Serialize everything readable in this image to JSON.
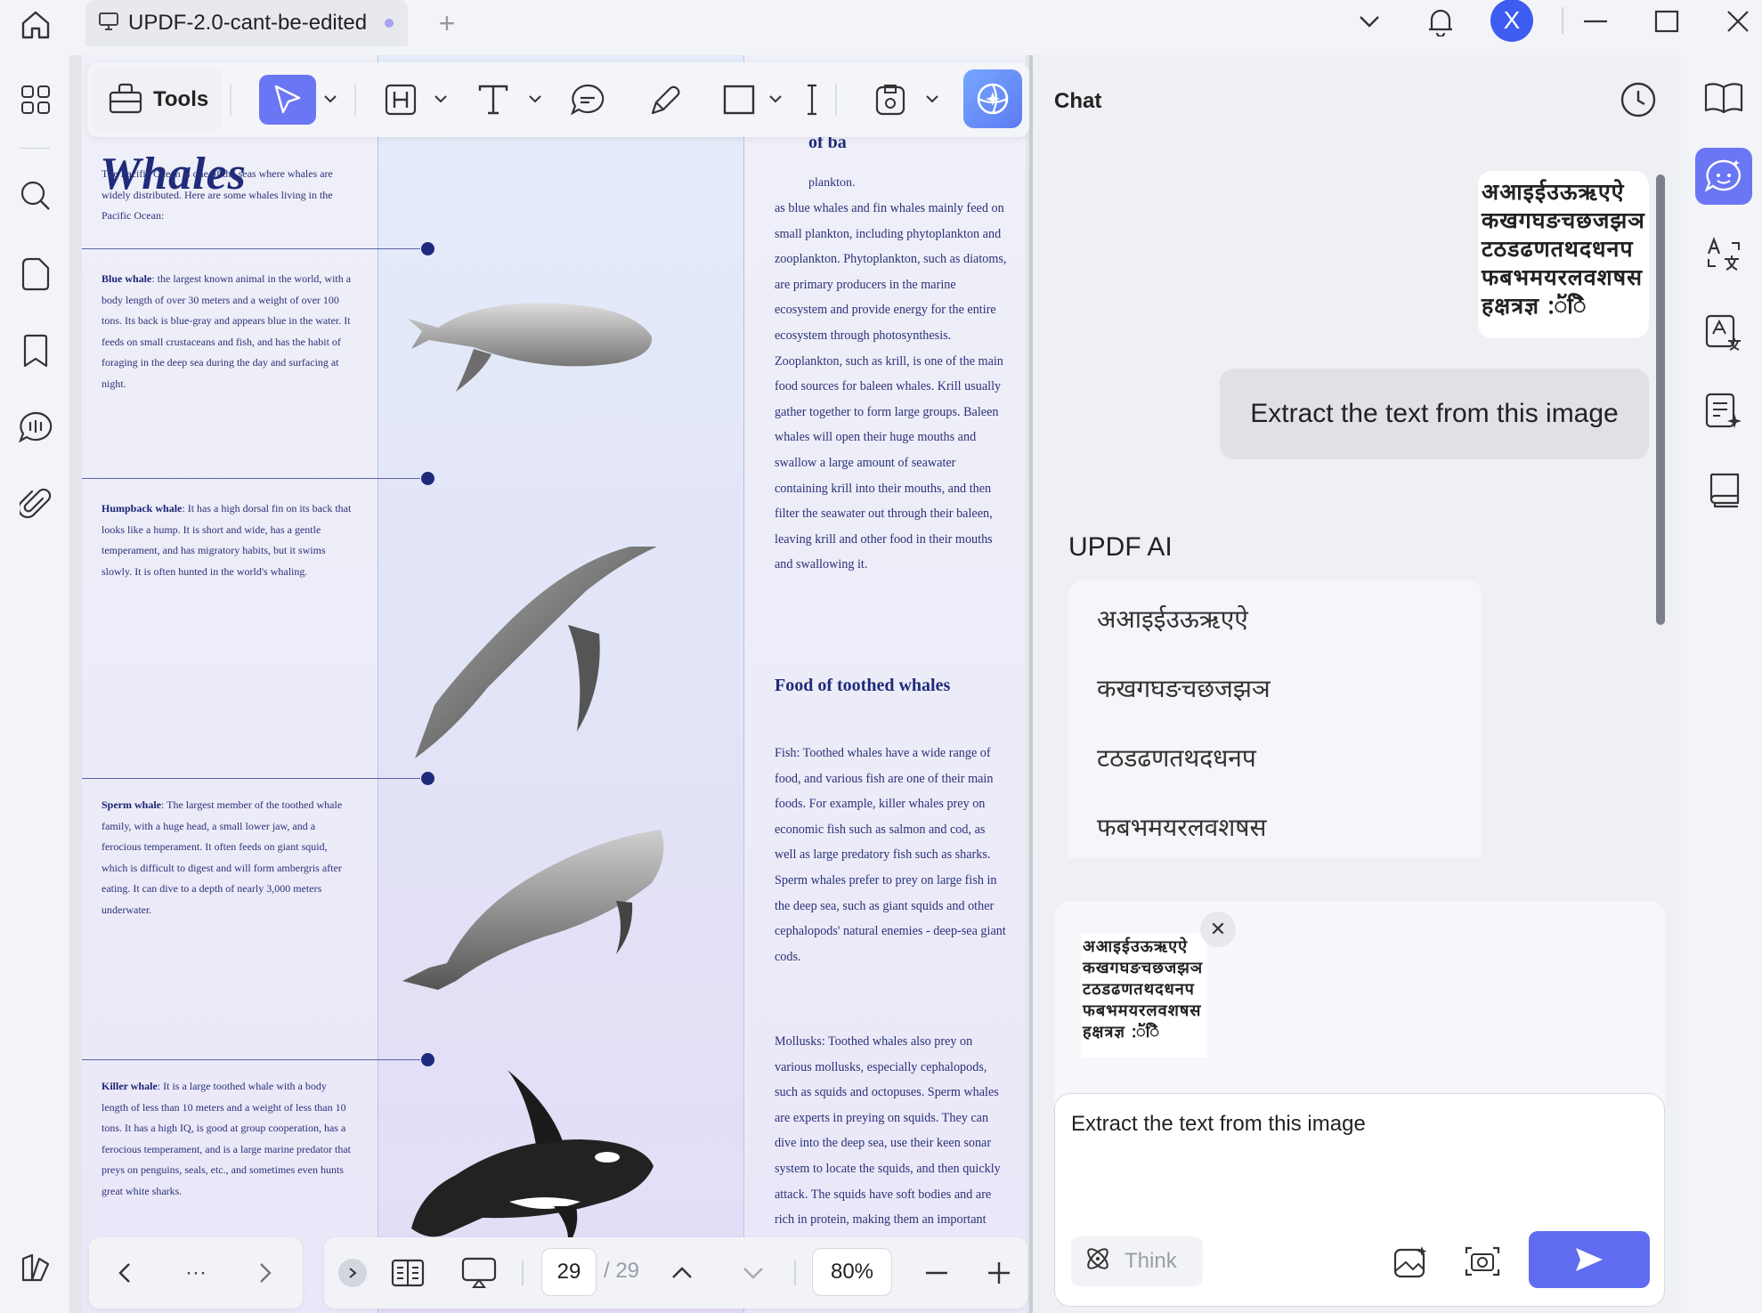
{
  "titlebar": {
    "tab_title": "UPDF-2.0-cant-be-edited",
    "avatar_letter": "X"
  },
  "toolbar": {
    "tools_label": "Tools"
  },
  "document": {
    "heading_fragment": "Whales",
    "intro": "The Pacific Ocean is one of the seas where whales are widely distributed. Here are some whales living in the Pacific Ocean:",
    "whales": [
      {
        "name": "Blue whale",
        "text": ": the largest known animal in the world, with a body length of over 30 meters and a weight of over 100 tons. Its back is blue-gray and appears blue in the water. It feeds on small crustaceans and fish, and has the habit of foraging in the deep sea during the day and surfacing at night."
      },
      {
        "name": "Humpback whale",
        "text": ": It has a high dorsal fin on its back that looks like a hump. It is short and wide, has a gentle temperament, and has migratory habits, but it swims slowly. It is often hunted in the world's whaling."
      },
      {
        "name": "Sperm whale",
        "text": ": The largest member of the toothed whale family, with a huge head, a small lower jaw, and a ferocious temperament. It often feeds on giant squid, which is difficult to digest and will form ambergris after eating. It can dive to a depth of nearly 3,000 meters underwater."
      },
      {
        "name": "Killer whale",
        "text": ": It is a large toothed whale with a body length of less than 10 meters and a weight of less than 10 tons. It has a high IQ, is good at group cooperation, has a ferocious temperament, and is a large marine predator that preys on penguins, seals, etc., and sometimes even hunts great white sharks."
      }
    ],
    "right_heading_fragment": "of ba",
    "right_line_fragment": "plankton.",
    "baleen_text": "as blue whales and fin whales mainly feed on small plankton, including phytoplankton and zooplankton. Phytoplankton, such as diatoms, are primary producers in the marine ecosystem and provide energy for the entire ecosystem through photosynthesis. Zooplankton, such as krill, is one of the main food sources for baleen whales. Krill usually gather together to form large groups. Baleen whales will open their huge mouths and swallow a large amount of seawater containing krill into their mouths, and then filter the seawater out through their baleen, leaving krill and other food in their mouths and swallowing it.",
    "toothed_heading": "Food of toothed whales",
    "fish_text": "Fish: Toothed whales have a wide range of food, and various fish are one of their main foods. For example, killer whales prey on economic fish such as salmon and cod, as well as large predatory fish such as sharks. Sperm whales prefer to prey on large fish in the deep sea, such as giant squids and other cephalopods' natural enemies - deep-sea giant cods.",
    "mollusks_text": "Mollusks: Toothed whales also prey on various mollusks, especially cephalopods, such as squids and octopuses. Sperm whales are experts in preying on squids. They can dive into the deep sea, use their keen sonar system to locate the squids, and then quickly attack. The squids have soft bodies and are rich in protein, making them an important food"
  },
  "bottombar": {
    "more": "···",
    "current_page": "29",
    "total_pages": "/ 29",
    "zoom": "80%"
  },
  "chat": {
    "title": "Chat",
    "user_message": "Extract the text from this image",
    "ai_label": "UPDF AI",
    "ai_lines": [
      "अआइईउऊऋएऐ",
      "कखगघङचछजझञ",
      "टठडढणतथदधनप",
      "फबभमयरलवशषस"
    ],
    "image_lines": [
      "अआइईउऊऋएऐ",
      "कखगघङचछजझञ",
      "टठडढणतथदधनप",
      "फबभमयरलवशषस",
      "हक्षत्रज्ञ :ॅ॑ॆि"
    ],
    "input_value": "Extract the text from this image",
    "think_label": "Think"
  },
  "colors": {
    "accent": "#6b76f5",
    "avatar": "#3f5cf0",
    "send": "#5f6cf0",
    "doc_text": "#2a3178"
  }
}
